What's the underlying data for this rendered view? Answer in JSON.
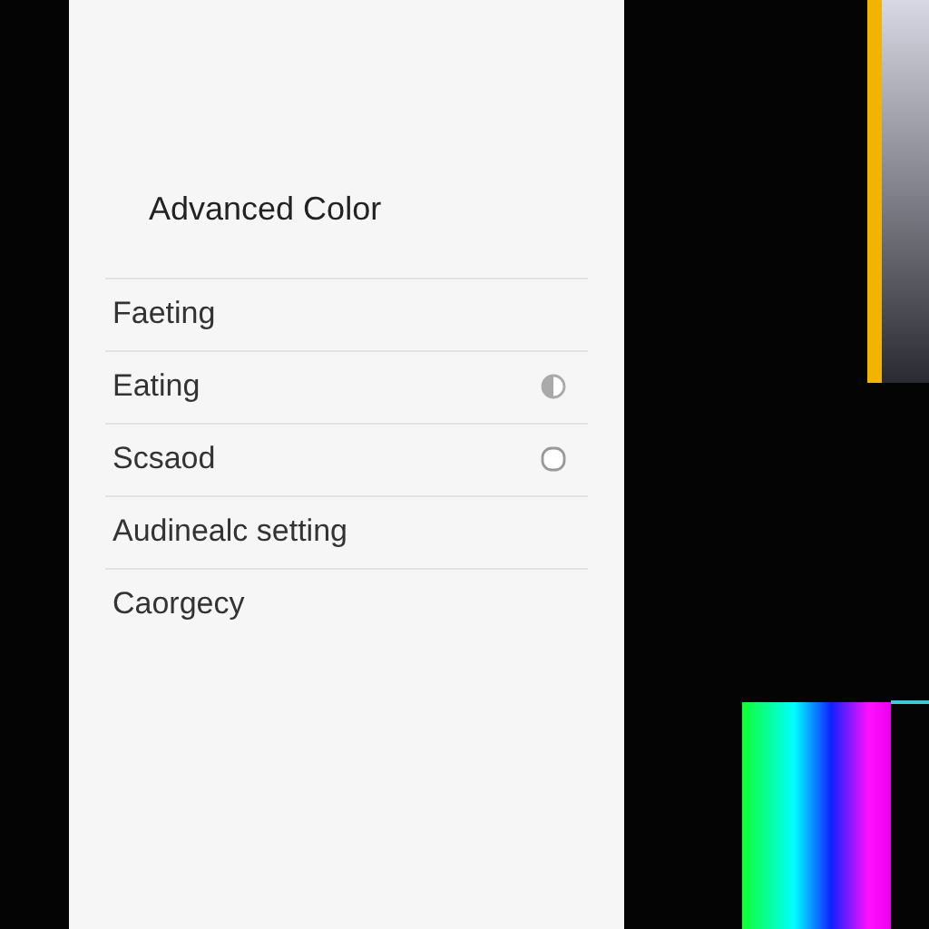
{
  "panel": {
    "title": "Advanced Color",
    "items": [
      {
        "label": "Faeting",
        "kind": "plain"
      },
      {
        "label": "Eating",
        "kind": "half"
      },
      {
        "label": "Scsaod",
        "kind": "empty"
      },
      {
        "label": "Audinealc setting",
        "kind": "plain"
      },
      {
        "label": "Caorgecy",
        "kind": "plain"
      }
    ]
  }
}
